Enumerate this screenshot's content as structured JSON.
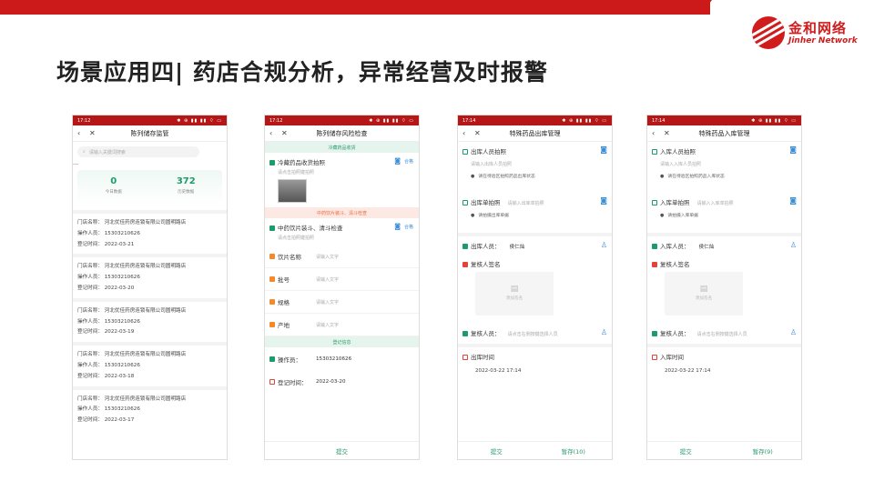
{
  "title": "场景应用四| 药店合规分析，异常经营及时报警",
  "logo": {
    "cn": "金和网络",
    "en": "Jinher Network"
  },
  "status_bar": {
    "time": "17:12",
    "time2": "17:14",
    "icons": "✱ ⊕ ▮▮ ▮▮ ⌔ ▭"
  },
  "phone1": {
    "title": "陈列储存监管",
    "search_placeholder": "请输入关键词搜索",
    "more": "···",
    "stats": [
      {
        "value": "0",
        "label": "今日数据"
      },
      {
        "value": "372",
        "label": "历史数据"
      }
    ],
    "records": [
      {
        "store": "门店名称：  河北优佳药房连锁有限公司圆明路店",
        "operator": "操作人员：  15303210626",
        "date": "登记时间：  2022-03-21"
      },
      {
        "store": "门店名称：  河北优佳药房连锁有限公司圆明路店",
        "operator": "操作人员：  15303210626",
        "date": "登记时间：  2022-03-20"
      },
      {
        "store": "门店名称：  河北优佳药房连锁有限公司圆明路店",
        "operator": "操作人员：  15303210626",
        "date": "登记时间：  2022-03-19"
      },
      {
        "store": "门店名称：  河北优佳药房连锁有限公司圆明路店",
        "operator": "操作人员：  15303210626",
        "date": "登记时间：  2022-03-18"
      },
      {
        "store": "门店名称：  河北优佳药房连锁有限公司圆明路店",
        "operator": "操作人员：  15303210626",
        "date": "登记时间：  2022-03-17"
      }
    ]
  },
  "phone2": {
    "title": "陈列储存风险检查",
    "sec1": "冷藏药品收货",
    "item1": "冷藏药品收货拍照",
    "ok": "合格",
    "photo_hint": "请点击拍照键拍照",
    "sec2": "中药饮片装斗、清斗检查",
    "item2": "中药饮片装斗、清斗检查",
    "fields": [
      {
        "label": "饮片名称",
        "placeholder": "请输入文字"
      },
      {
        "label": "批号",
        "placeholder": "请输入文字"
      },
      {
        "label": "规格",
        "placeholder": "请输入文字"
      },
      {
        "label": "产地",
        "placeholder": "请输入文字"
      }
    ],
    "sec3": "登记信息",
    "operator_label": "操作员：",
    "operator_value": "15303210626",
    "time_label": "登记时间：",
    "time_value": "2022-03-20",
    "submit": "提交"
  },
  "phone3": {
    "title": "特殊药品出库管理",
    "photo_label": "出库人员拍照",
    "photo_hint": "请输入出库人员拍照",
    "area_hint": "请在待验区拍照药品出库状态",
    "doc_label": "出库单拍照",
    "doc_hint": "请输入出库单拍照",
    "doc_sub": "请拍摄出库单据",
    "person_label": "出库人员：",
    "person_value": "侯仁灿",
    "sign_label": "复核人签名",
    "sign_box": "添加签名",
    "reviewer_label": "复核人员：",
    "reviewer_hint": "请点击右侧按键选择人员",
    "time_label": "出库时间",
    "time_value": "2022-03-22 17:14",
    "submit": "提交",
    "draft": "暂存(10)"
  },
  "phone4": {
    "title": "特殊药品入库管理",
    "photo_label": "入库人员拍照",
    "photo_hint": "请输入入库人员拍照",
    "area_hint": "请在待验区拍照药品入库状态",
    "doc_label": "入库单拍照",
    "doc_hint": "请输入入库单拍照",
    "doc_sub": "请拍摄入库单据",
    "person_label": "入库人员：",
    "person_value": "侯仁灿",
    "sign_label": "复核人签名",
    "sign_box": "添加签名",
    "reviewer_label": "复核人员：",
    "reviewer_hint": "请点击右侧按键选择人员",
    "time_label": "入库时间",
    "time_value": "2022-03-22 17:14",
    "submit": "提交",
    "draft": "暂存(9)"
  }
}
